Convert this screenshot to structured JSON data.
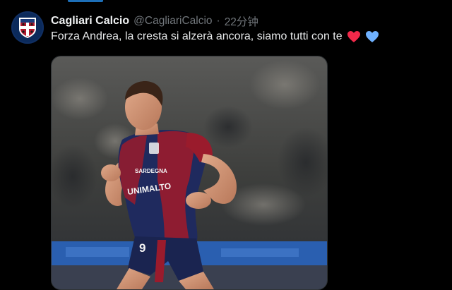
{
  "tweet": {
    "display_name": "Cagliari Calcio",
    "handle": "@CagliariCalcio",
    "separator": "·",
    "time": "22分钟",
    "text": "Forza Andrea, la cresta si alzerà ancora, siamo tutti con te",
    "emojis": [
      "red-heart",
      "light-blue-heart"
    ]
  },
  "photo": {
    "shirt_number": "9",
    "sponsor_top": "SARDEGNA",
    "sponsor_main": "UNIMALTO",
    "colors": {
      "shirt_blue": "#1f2a5e",
      "shirt_red": "#9a1b2c",
      "pitch_band": "#2a5fb0"
    }
  },
  "colors": {
    "background": "#000000",
    "text_primary": "#e7e9ea",
    "text_secondary": "#71767b",
    "heart_red": "#f2294a",
    "heart_blue": "#6fb1ff",
    "accent_strip": "#1d6fb8"
  }
}
